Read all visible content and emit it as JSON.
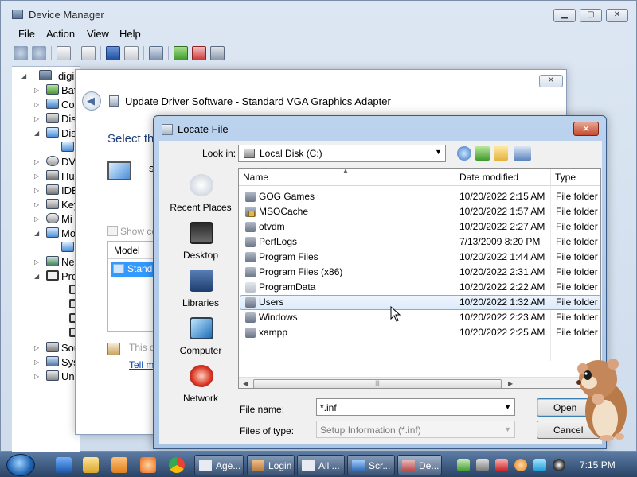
{
  "device_manager": {
    "title": "Device Manager",
    "menu": [
      "File",
      "Action",
      "View",
      "Help"
    ],
    "tree": {
      "root": "digibro",
      "items": [
        "Bat",
        "Co",
        "Dis",
        "Dis",
        "",
        "DV",
        "Hu",
        "IDE",
        "Key",
        "Mi",
        "Mo",
        "",
        "Ne",
        "Pro",
        "",
        "",
        "",
        "",
        "Sou",
        "Sys",
        "Un"
      ]
    }
  },
  "wizard": {
    "title": "Update Driver Software - Standard VGA Graphics Adapter",
    "heading": "Select th",
    "heading_tail": "s",
    "show_compatible": "Show co",
    "model_header": "Model",
    "model_item": "Stand",
    "signed_text": "This d",
    "link": "Tell m"
  },
  "locate_file": {
    "title": "Locate File",
    "look_in_label": "Look in:",
    "look_in_value": "Local Disk (C:)",
    "places": [
      "Recent Places",
      "Desktop",
      "Libraries",
      "Computer",
      "Network"
    ],
    "columns": [
      "Name",
      "Date modified",
      "Type"
    ],
    "rows": [
      {
        "name": "GOG Games",
        "date": "10/20/2022 2:15 AM",
        "type": "File folder"
      },
      {
        "name": "MSOCache",
        "date": "10/20/2022 1:57 AM",
        "type": "File folder"
      },
      {
        "name": "otvdm",
        "date": "10/20/2022 2:27 AM",
        "type": "File folder"
      },
      {
        "name": "PerfLogs",
        "date": "7/13/2009 8:20 PM",
        "type": "File folder"
      },
      {
        "name": "Program Files",
        "date": "10/20/2022 1:44 AM",
        "type": "File folder"
      },
      {
        "name": "Program Files (x86)",
        "date": "10/20/2022 2:31 AM",
        "type": "File folder"
      },
      {
        "name": "ProgramData",
        "date": "10/20/2022 2:22 AM",
        "type": "File folder"
      },
      {
        "name": "Users",
        "date": "10/20/2022 1:32 AM",
        "type": "File folder"
      },
      {
        "name": "Windows",
        "date": "10/20/2022 2:23 AM",
        "type": "File folder"
      },
      {
        "name": "xampp",
        "date": "10/20/2022 2:25 AM",
        "type": "File folder"
      }
    ],
    "file_name_label": "File name:",
    "file_name_value": "*.inf",
    "file_type_label": "Files of type:",
    "file_type_value": "Setup Information (*.inf)",
    "open_label": "Open",
    "cancel_label": "Cancel"
  },
  "taskbar": {
    "buttons": [
      "Age...",
      "Login",
      "All ...",
      "Scr...",
      "De..."
    ],
    "clock": "7:15 PM"
  }
}
